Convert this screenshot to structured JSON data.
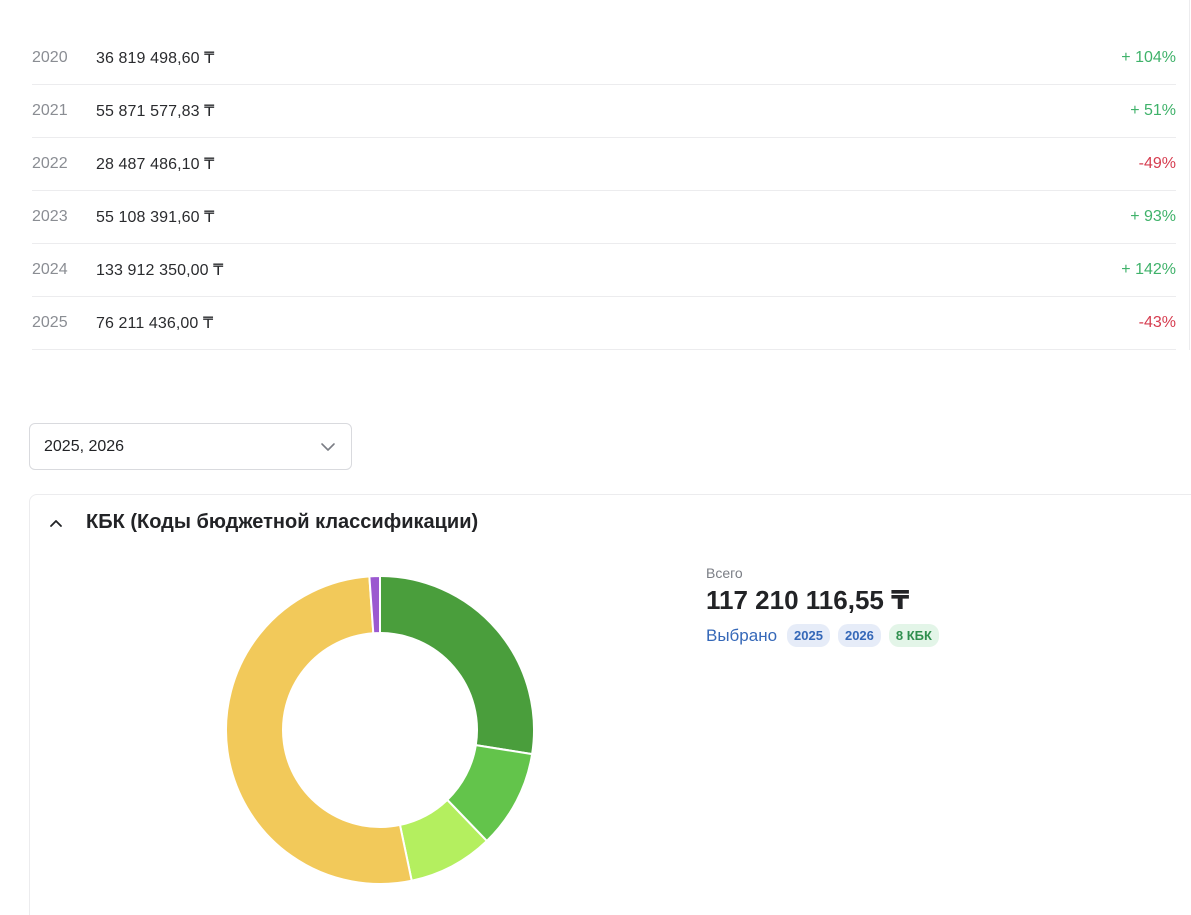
{
  "years_table": [
    {
      "year": "2020",
      "amount": "36 819 498,60 ₸",
      "change": "+ 104%",
      "trend": "pos"
    },
    {
      "year": "2021",
      "amount": "55 871 577,83 ₸",
      "change": "+ 51%",
      "trend": "pos"
    },
    {
      "year": "2022",
      "amount": "28 487 486,10 ₸",
      "change": "-49%",
      "trend": "neg"
    },
    {
      "year": "2023",
      "amount": "55 108 391,60 ₸",
      "change": "+ 93%",
      "trend": "pos"
    },
    {
      "year": "2024",
      "amount": "133 912 350,00 ₸",
      "change": "+ 142%",
      "trend": "pos"
    },
    {
      "year": "2025",
      "amount": "76 211 436,00 ₸",
      "change": "-43%",
      "trend": "neg"
    }
  ],
  "year_select": {
    "value": "2025, 2026",
    "icon": "chevron-down-icon"
  },
  "kbk_card": {
    "title": "КБК (Коды бюджетной классификации)",
    "toggle_icon": "chevron-up-icon",
    "summary": {
      "total_label": "Всего",
      "total_value": "117 210 116,55 ₸",
      "selected_label": "Выбрано",
      "chips": [
        {
          "text": "2025",
          "kind": "year"
        },
        {
          "text": "2026",
          "kind": "year"
        },
        {
          "text": "8 КБК",
          "kind": "kbk"
        }
      ]
    }
  },
  "chart_data": {
    "type": "pie",
    "variant": "donut",
    "slices": [
      {
        "share": 0.275,
        "color": "#4a9e3c"
      },
      {
        "share": 0.103,
        "color": "#63c44b"
      },
      {
        "share": 0.089,
        "color": "#b4ef5f"
      },
      {
        "share": 0.522,
        "color": "#f2c95a"
      },
      {
        "share": 0.011,
        "color": "#9b59d0"
      }
    ]
  },
  "colors": {
    "positive": "#3fb26a",
    "negative": "#d63c4f",
    "link": "#3568b8"
  }
}
